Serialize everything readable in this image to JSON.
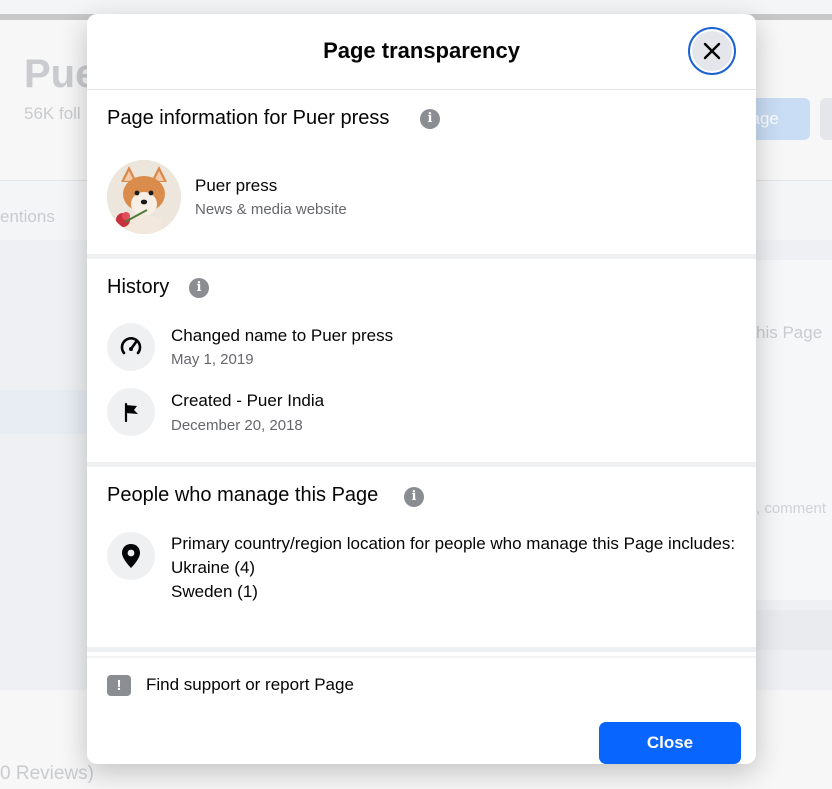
{
  "background": {
    "page_title": "Pue",
    "followers": "56K foll",
    "message_button": "sage",
    "mentions_tab": "entions",
    "this_page_text": "his Page",
    "comment_text": ", comment",
    "reviews_text": "0 Reviews)"
  },
  "modal": {
    "title": "Page transparency",
    "close_icon": "close-icon",
    "page_info": {
      "title": "Page information for Puer press",
      "info_icon": "info-icon",
      "page_name": "Puer press",
      "category": "News & media website"
    },
    "history": {
      "title": "History",
      "info_icon": "info-icon",
      "items": [
        {
          "icon": "speedometer-icon",
          "title": "Changed name to Puer press",
          "date": "May 1, 2019"
        },
        {
          "icon": "flag-icon",
          "title": "Created - Puer India",
          "date": "December 20, 2018"
        }
      ]
    },
    "people": {
      "title": "People who manage this Page",
      "info_icon": "info-icon",
      "location_icon": "location-pin-icon",
      "description": "Primary country/region location for people who manage this Page includes:",
      "countries": [
        "Ukraine (4)",
        "Sweden (1)"
      ]
    },
    "support": {
      "icon": "warning-icon",
      "text": "Find support or report Page"
    },
    "close_button": "Close"
  },
  "colors": {
    "primary_button": "#0866ff",
    "focus_ring": "#1b64d1",
    "info_icon": "#8a8d91",
    "secondary_text": "#65676b"
  }
}
